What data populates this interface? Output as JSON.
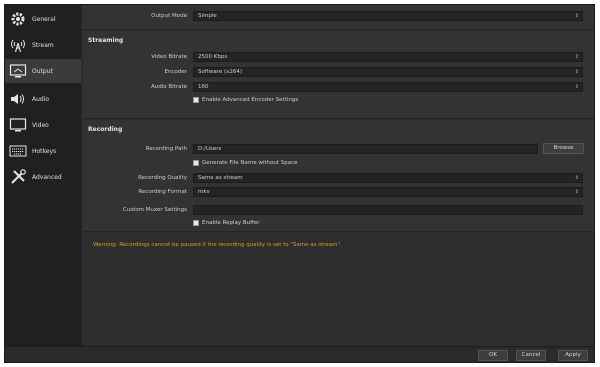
{
  "sidebar": {
    "items": [
      {
        "label": "General",
        "icon": "gear-icon"
      },
      {
        "label": "Stream",
        "icon": "broadcast-icon"
      },
      {
        "label": "Output",
        "icon": "monitor-output-icon",
        "active": true
      },
      {
        "label": "Audio",
        "icon": "speaker-icon"
      },
      {
        "label": "Video",
        "icon": "display-icon"
      },
      {
        "label": "Hotkeys",
        "icon": "keyboard-icon"
      },
      {
        "label": "Advanced",
        "icon": "tools-icon"
      }
    ]
  },
  "output_mode": {
    "label": "Output Mode",
    "value": "Simple"
  },
  "streaming": {
    "title": "Streaming",
    "video_bitrate": {
      "label": "Video Bitrate",
      "value": "2500 Kbps"
    },
    "encoder": {
      "label": "Encoder",
      "value": "Software (x264)"
    },
    "audio_bitrate": {
      "label": "Audio Bitrate",
      "value": "160"
    },
    "advanced_encoder": {
      "label": "Enable Advanced Encoder Settings"
    }
  },
  "recording": {
    "title": "Recording",
    "path": {
      "label": "Recording Path",
      "value": "D:/Users"
    },
    "browse_label": "Browse",
    "no_space": {
      "label": "Generate File Name without Space"
    },
    "quality": {
      "label": "Recording Quality",
      "value": "Same as stream"
    },
    "format": {
      "label": "Recording Format",
      "value": "mkv"
    },
    "muxer": {
      "label": "Custom Muxer Settings",
      "value": ""
    },
    "replay_buffer": {
      "label": "Enable Replay Buffer"
    }
  },
  "warning": "Warning: Recordings cannot be paused if the recording quality is set to \"Same as stream\".",
  "buttons": {
    "ok": "OK",
    "cancel": "Cancel",
    "apply": "Apply"
  },
  "colors": {
    "warning": "#c9a227",
    "active_item": "#3b3b3b"
  }
}
